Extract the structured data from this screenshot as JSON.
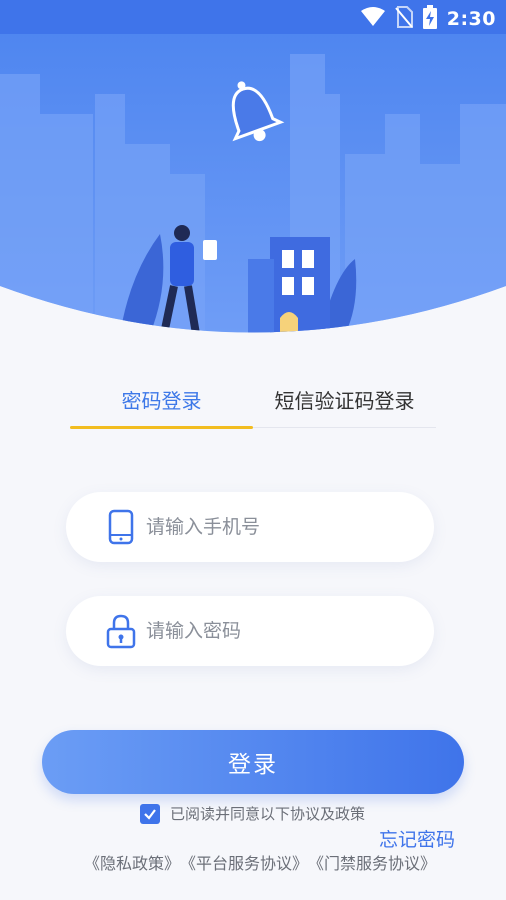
{
  "status_bar": {
    "time": "2:30",
    "icons": [
      "wifi-icon",
      "no-sim-icon",
      "battery-charging-icon"
    ]
  },
  "hero": {
    "illustration": "city-notification-illustration",
    "colors": {
      "sky": "#5a8ef5",
      "buildings": "#7aa5f7"
    }
  },
  "tabs": [
    {
      "label": "密码登录",
      "active": true
    },
    {
      "label": "短信验证码登录",
      "active": false
    }
  ],
  "form": {
    "phone": {
      "placeholder": "请输入手机号",
      "value": "",
      "icon": "phone-icon"
    },
    "password": {
      "placeholder": "请输入密码",
      "value": "",
      "icon": "lock-icon"
    }
  },
  "login_button": {
    "label": "登录"
  },
  "agreement": {
    "checked": true,
    "text": "已阅读并同意以下协议及政策"
  },
  "forgot_password": {
    "label": "忘记密码"
  },
  "policies": [
    "《隐私政策》",
    "《平台服务协议》",
    "《门禁服务协议》"
  ],
  "colors": {
    "accent": "#3f74ea",
    "tab_underline": "#f2bd20",
    "background": "#f6f7fb"
  }
}
